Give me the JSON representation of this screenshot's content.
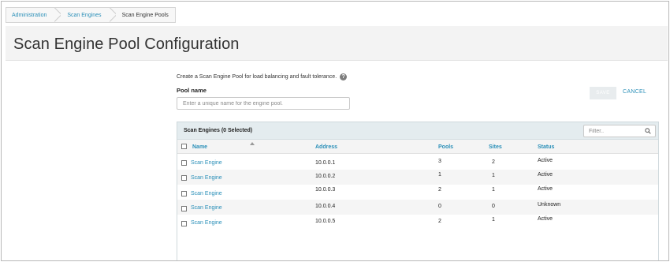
{
  "breadcrumb": {
    "items": [
      "Administration",
      "Scan Engines",
      "Scan Engine Pools"
    ]
  },
  "page": {
    "title": "Scan Engine Pool Configuration",
    "description": "Create a Scan Engine Pool for load balancing and fault tolerance."
  },
  "form": {
    "pool_name_label": "Pool name",
    "pool_name_placeholder": "Enter a unique name for the engine pool.",
    "pool_name_value": "",
    "save_label": "SAVE",
    "cancel_label": "CANCEL"
  },
  "engines_table": {
    "title": "Scan Engines (0 Selected)",
    "filter_placeholder": "Filter..",
    "columns": [
      "Name",
      "Address",
      "Pools",
      "Sites",
      "Status"
    ],
    "rows": [
      {
        "name": "Scan Engine",
        "address": "10.0.0.1",
        "pools": "3",
        "sites": "2",
        "status": "Active"
      },
      {
        "name": "Scan Engine",
        "address": "10.0.0.2",
        "pools": "1",
        "sites": "1",
        "status": "Active"
      },
      {
        "name": "Scan Engine",
        "address": "10.0.0.3",
        "pools": "2",
        "sites": "1",
        "status": "Active"
      },
      {
        "name": "Scan Engine",
        "address": "10.0.0.4",
        "pools": "0",
        "sites": "0",
        "status": "Unknown"
      },
      {
        "name": "Scan Engine",
        "address": "10.0.0.5",
        "pools": "2",
        "sites": "1",
        "status": "Active"
      }
    ]
  },
  "colors": {
    "link": "#2a8fb8",
    "panel_header": "#e4ecef"
  },
  "icons": {
    "help": "question-circle-icon",
    "search": "search-icon",
    "sort": "sort-asc-icon"
  }
}
